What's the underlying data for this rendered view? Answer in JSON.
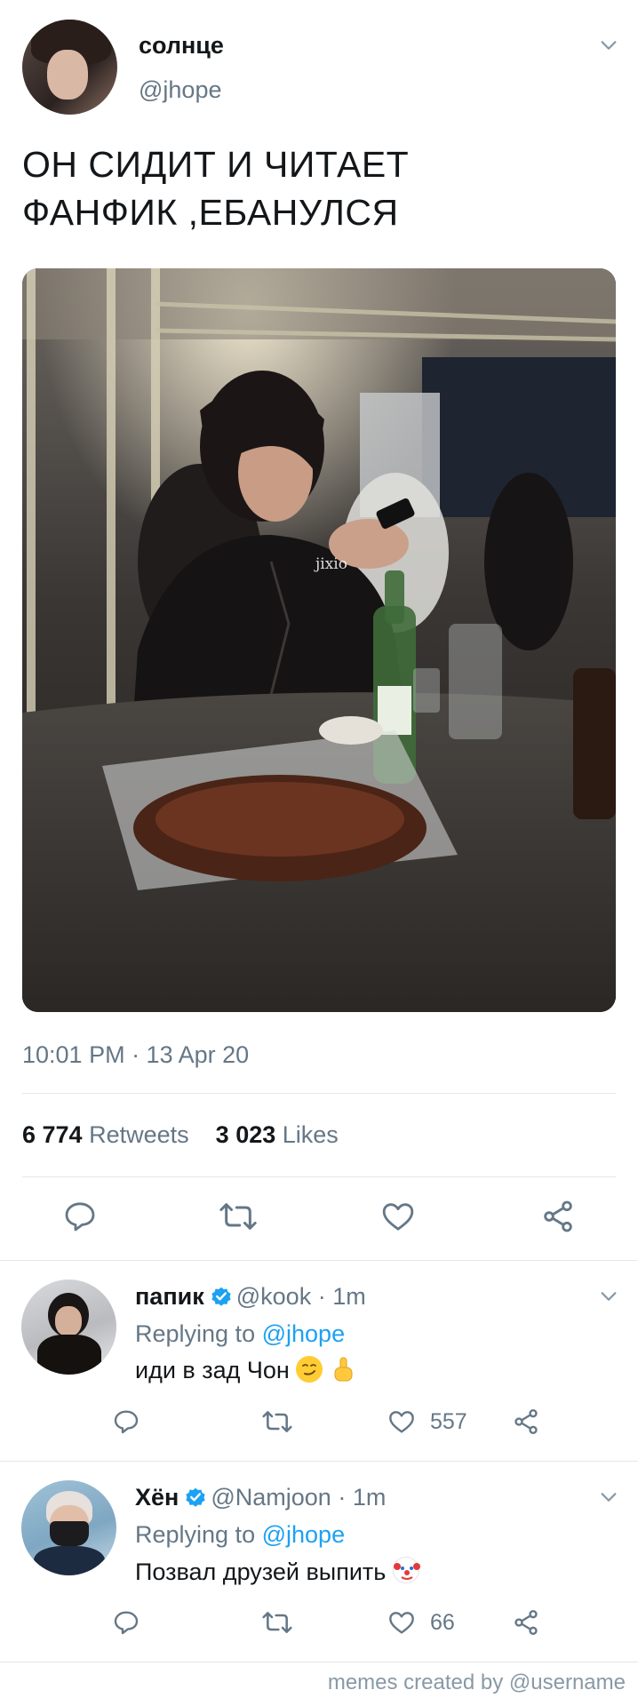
{
  "tweet": {
    "display_name": "солнце",
    "handle": "@jhope",
    "text_line1": "ОН СИДИТ И ЧИТАЕТ",
    "text_line2": "ФАНФИК ,ЕБАНУЛСЯ",
    "photo_watermark": "jixio",
    "timestamp": "10:01 PM · 13 Apr 20",
    "retweets_count": "6 774",
    "retweets_label": "Retweets",
    "likes_count": "3 023",
    "likes_label": "Likes"
  },
  "replies": [
    {
      "display_name": "папик",
      "handle": "@kook",
      "time": "· 1m",
      "replying_prefix": "Replying to",
      "replying_handle": "@jhope",
      "text": "иди в зад Чон",
      "emojis": [
        "smirk-emoji",
        "middle-finger-emoji"
      ],
      "likes": "557"
    },
    {
      "display_name": "Хён",
      "handle": "@Namjoon",
      "time": "· 1m",
      "replying_prefix": "Replying to",
      "replying_handle": "@jhope",
      "text": "Позвал друзей выпить",
      "emojis": [
        "clown-emoji"
      ],
      "likes": "66"
    }
  ],
  "footer": {
    "credit": "memes created by @username"
  },
  "icons": [
    "chevron-down-icon",
    "reply-icon",
    "retweet-icon",
    "like-icon",
    "share-icon",
    "verified-icon"
  ],
  "colors": {
    "link": "#1da1f2",
    "secondary_text": "#657786",
    "divider": "#e1e8ed",
    "text": "#14171a"
  }
}
